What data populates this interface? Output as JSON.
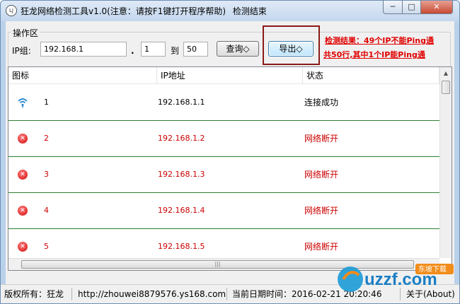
{
  "window": {
    "icon_text": "LJ",
    "title": "狂龙网络检测工具v1.0(注意：请按F1键打开程序帮助)",
    "title_status": "检测结束",
    "min_glyph": "─",
    "max_glyph": "□",
    "close_glyph": "✕"
  },
  "operation": {
    "group_label": "操作区",
    "ip_label": "IP组:",
    "ip_prefix": "192.168.1",
    "dot": ".",
    "range_start": "1",
    "to_label": "到",
    "range_end": "50",
    "query_button": "查询◇",
    "export_button": "导出◇"
  },
  "result": {
    "line1": "检测结果：49个IP不能Ping通",
    "line2": "共50行,其中1个IP能Ping通"
  },
  "table": {
    "columns": [
      "图标",
      "IP地址",
      "状态"
    ],
    "rows": [
      {
        "num": "1",
        "ip": "192.168.1.1",
        "status": "连接成功",
        "ok": true
      },
      {
        "num": "2",
        "ip": "192.168.1.2",
        "status": "网络断开",
        "ok": false
      },
      {
        "num": "3",
        "ip": "192.168.1.3",
        "status": "网络断开",
        "ok": false
      },
      {
        "num": "4",
        "ip": "192.168.1.4",
        "status": "网络断开",
        "ok": false
      },
      {
        "num": "5",
        "ip": "192.168.1.5",
        "status": "网络断开",
        "ok": false
      }
    ],
    "scroll_up": "▲",
    "scroll_grip": "|||"
  },
  "statusbar": {
    "copyright": "版权所有：狂龙",
    "url": "http://zhouwei8879576.ys168.com",
    "date": "当前日期时间：2016-02-21 20:20:46",
    "about": "关于(About)"
  },
  "watermark": {
    "text": "uzzf.com",
    "badge": "东坡下载"
  },
  "colors": {
    "error": "#cc0000",
    "row_border": "#2e7d2e",
    "result": "#e00000",
    "highlight_frame": "#8b1a1a"
  }
}
